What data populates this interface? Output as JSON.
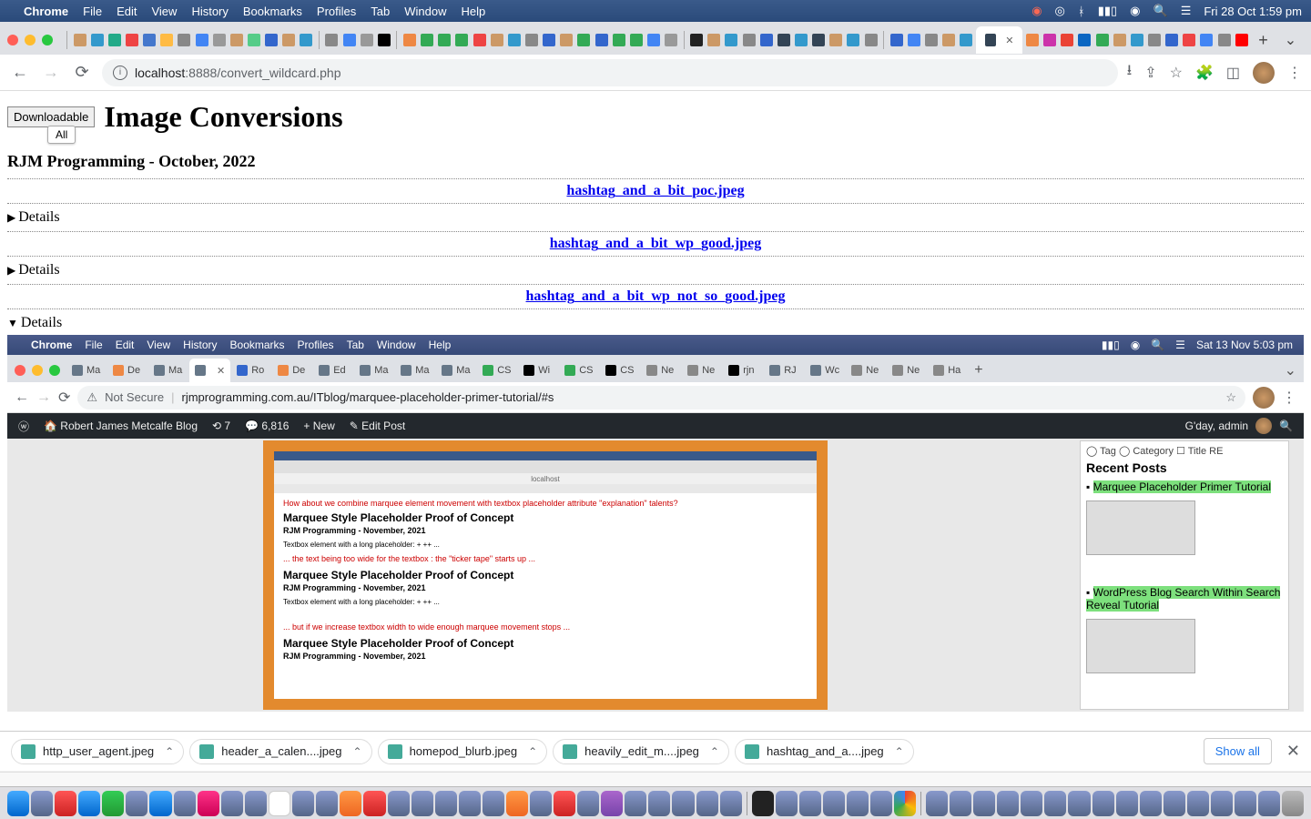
{
  "menubar": {
    "apple": "",
    "app": "Chrome",
    "items": [
      "File",
      "Edit",
      "View",
      "History",
      "Bookmarks",
      "Profiles",
      "Tab",
      "Window",
      "Help"
    ],
    "right_icons": [
      "patreon-icon",
      "record-icon",
      "bluetooth-icon",
      "battery-icon",
      "wifi-icon",
      "search-icon",
      "control-center-icon"
    ],
    "clock": "Fri 28 Oct  1:59 pm"
  },
  "browser": {
    "nav": {
      "back": "←",
      "fwd": "→",
      "reload": "⟳"
    },
    "omnibox": {
      "host": "localhost",
      "port": ":8888",
      "path": "/convert_wildcard.php"
    },
    "toolbar_icons": [
      "download-icon",
      "share-icon",
      "star-icon",
      "extensions-icon",
      "sidepanel-icon"
    ],
    "menu": "⋮",
    "active_tab_close": "✕",
    "new_tab": "+",
    "overflow": "⌄"
  },
  "page": {
    "button": "Downloadable",
    "title": "Image Conversions",
    "tooltip": "All",
    "subtitle": "RJM Programming - October, 2022",
    "files": [
      "hashtag_and_a_bit_poc.jpeg",
      "hashtag_and_a_bit_wp_good.jpeg",
      "hashtag_and_a_bit_wp_not_so_good.jpeg"
    ],
    "details_label": "Details"
  },
  "inner": {
    "menubar": {
      "apple": "",
      "app": "Chrome",
      "items": [
        "File",
        "Edit",
        "View",
        "History",
        "Bookmarks",
        "Profiles",
        "Tab",
        "Window",
        "Help"
      ],
      "clock": "Sat 13 Nov  5:03 pm"
    },
    "tabs": [
      "Ma",
      "De",
      "Ma",
      "",
      "Ro",
      "De",
      "Ed",
      "Ma",
      "Ma",
      "Ma",
      "CS",
      "Wi",
      "CS",
      "CS",
      "Ne",
      "Ne",
      "rjn",
      "RJ",
      "Wc",
      "Ne",
      "Ne",
      "Ha"
    ],
    "url": "rjmprogramming.com.au/ITblog/marquee-placeholder-primer-tutorial/#s",
    "not_secure": "Not Secure",
    "wpbar": {
      "site": "Robert James Metcalfe Blog",
      "updates": "7",
      "comments": "6,816",
      "new": "New",
      "edit": "Edit Post",
      "greeting": "G'day, admin"
    },
    "shot": {
      "q": "How about we combine marquee element movement with textbox  placeholder attribute \"explanation\" talents?",
      "h": "Marquee Style Placeholder Proof of Concept",
      "by": "RJM Programming - November, 2021",
      "t1": "Textbox element with a long placeholder:  + ++ ...",
      "r1": "... the text being too wide for the textbox : the \"ticker tape\" starts up ...",
      "r2": "... but if we increase textbox width to wide enough marquee movement stops ...",
      "localhost": "localhost"
    },
    "side": {
      "filter": "◯ Tag ◯  Category ☐ Title RE",
      "heading": "Recent Posts",
      "post1": "Marquee Placeholder Primer Tutorial",
      "post2": "WordPress Blog Search Within Search Reveal Tutorial"
    }
  },
  "downloads": {
    "items": [
      "http_user_agent.jpeg",
      "header_a_calen....jpeg",
      "homepod_blurb.jpeg",
      "heavily_edit_m....jpeg",
      "hashtag_and_a....jpeg"
    ],
    "showall": "Show all",
    "close": "✕"
  }
}
